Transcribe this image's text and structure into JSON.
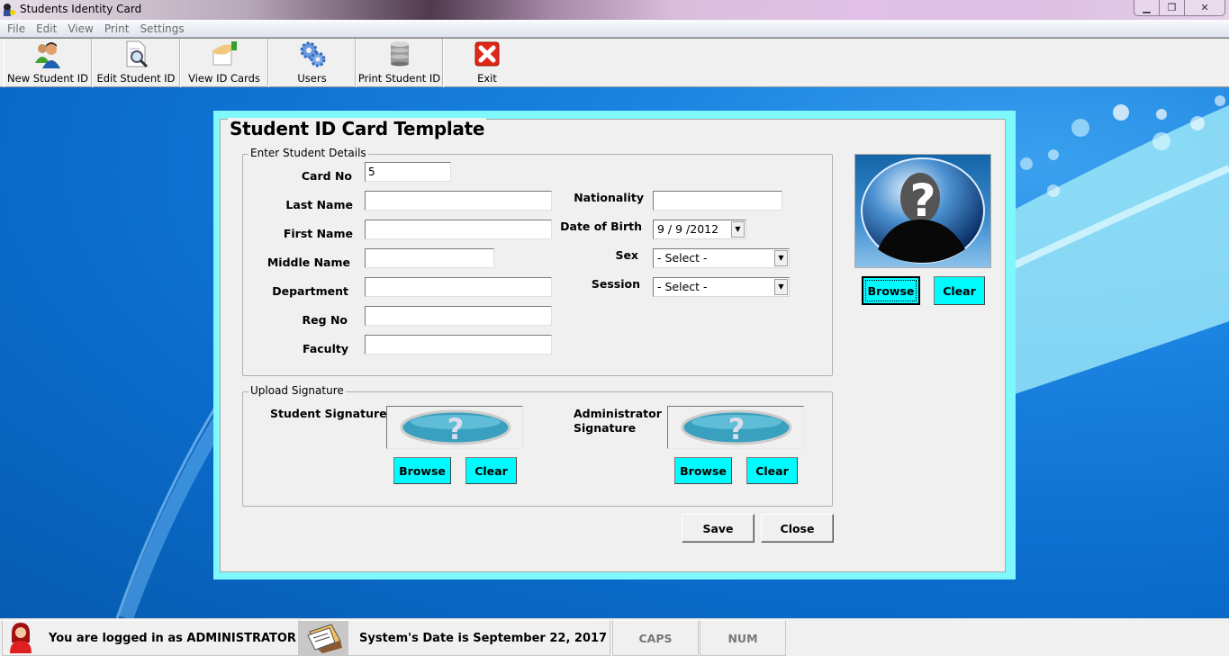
{
  "window": {
    "title": "Students Identity Card",
    "controls": [
      "minimize",
      "restore",
      "close"
    ]
  },
  "menu": [
    "File",
    "Edit",
    "View",
    "Print",
    "Settings"
  ],
  "toolbar": [
    {
      "label": "New Student ID",
      "icon": "users-icon"
    },
    {
      "label": "Edit Student ID",
      "icon": "document-search-icon"
    },
    {
      "label": "View ID Cards",
      "icon": "card-hand-icon"
    },
    {
      "label": "Users",
      "icon": "gears-icon"
    },
    {
      "label": "Print Student ID",
      "icon": "database-icon"
    },
    {
      "label": "Exit",
      "icon": "exit-icon"
    }
  ],
  "dialog": {
    "title": "Student ID Card Template",
    "details_group": "Enter Student Details",
    "fields_left": [
      {
        "label": "Card No",
        "value": "5"
      },
      {
        "label": "Last Name",
        "value": ""
      },
      {
        "label": "First Name",
        "value": ""
      },
      {
        "label": "Middle Name",
        "value": ""
      },
      {
        "label": "Department",
        "value": ""
      },
      {
        "label": "Reg No",
        "value": ""
      },
      {
        "label": "Faculty",
        "value": ""
      }
    ],
    "fields_right": {
      "nationality": {
        "label": "Nationality",
        "value": ""
      },
      "dob": {
        "label": "Date of Birth",
        "value": "9 / 9 /2012"
      },
      "sex": {
        "label": "Sex",
        "value": "- Select -"
      },
      "session": {
        "label": "Session",
        "value": "- Select -"
      }
    },
    "photo": {
      "browse": "Browse",
      "clear": "Clear"
    },
    "signature_group": "Upload Signature",
    "student_signature": {
      "label": "Student Signature",
      "browse": "Browse",
      "clear": "Clear"
    },
    "admin_signature": {
      "label_line1": "Administrator",
      "label_line2": "Signature",
      "browse": "Browse",
      "clear": "Clear"
    },
    "save": "Save",
    "close": "Close"
  },
  "statusbar": {
    "user": "You are logged in as ADMINISTRATOR",
    "date": "System's Date is September 22, 2017",
    "caps": "CAPS",
    "num": "NUM"
  },
  "colors": {
    "accent_cyan": "#00fbff",
    "dialog_frame": "#7ef8fa",
    "desktop_blue": "#0b6ccc"
  }
}
